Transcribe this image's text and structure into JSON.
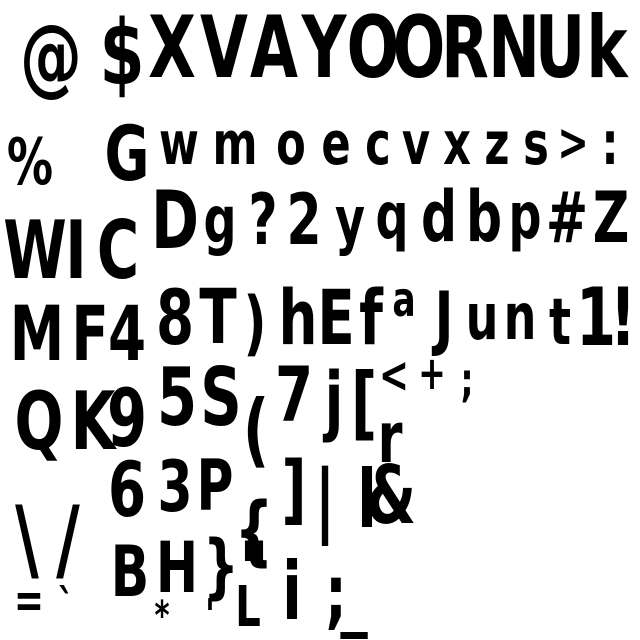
{
  "atlas": {
    "background": "#ffffff",
    "ink": "#000000",
    "glyphs": [
      "@",
      "$",
      "X",
      "V",
      "A",
      "Y",
      "O",
      "O",
      "R",
      "N",
      "U",
      "k",
      "%",
      "G",
      "w",
      "m",
      "o",
      "e",
      "c",
      "v",
      "x",
      "z",
      "s",
      ">",
      ":",
      "W",
      "I",
      "C",
      "D",
      "g",
      "?",
      "2",
      "y",
      "q",
      "d",
      "b",
      "p",
      "#",
      "Z",
      "M",
      "F",
      "4",
      "8",
      "T",
      ")",
      "h",
      "E",
      "f",
      "a",
      "J",
      "u",
      "n",
      "t",
      "1",
      "!",
      "Q",
      "K",
      "9",
      "5",
      "S",
      "(",
      "7",
      "j",
      "[",
      "<",
      "+",
      ";",
      "r",
      "\\",
      "/",
      "6",
      "3",
      "P",
      "{",
      "]",
      "|",
      "l",
      "&",
      "B",
      "H",
      "}",
      "\"",
      "=",
      "`",
      "*",
      "'",
      "L",
      "i",
      ";",
      "_"
    ]
  }
}
